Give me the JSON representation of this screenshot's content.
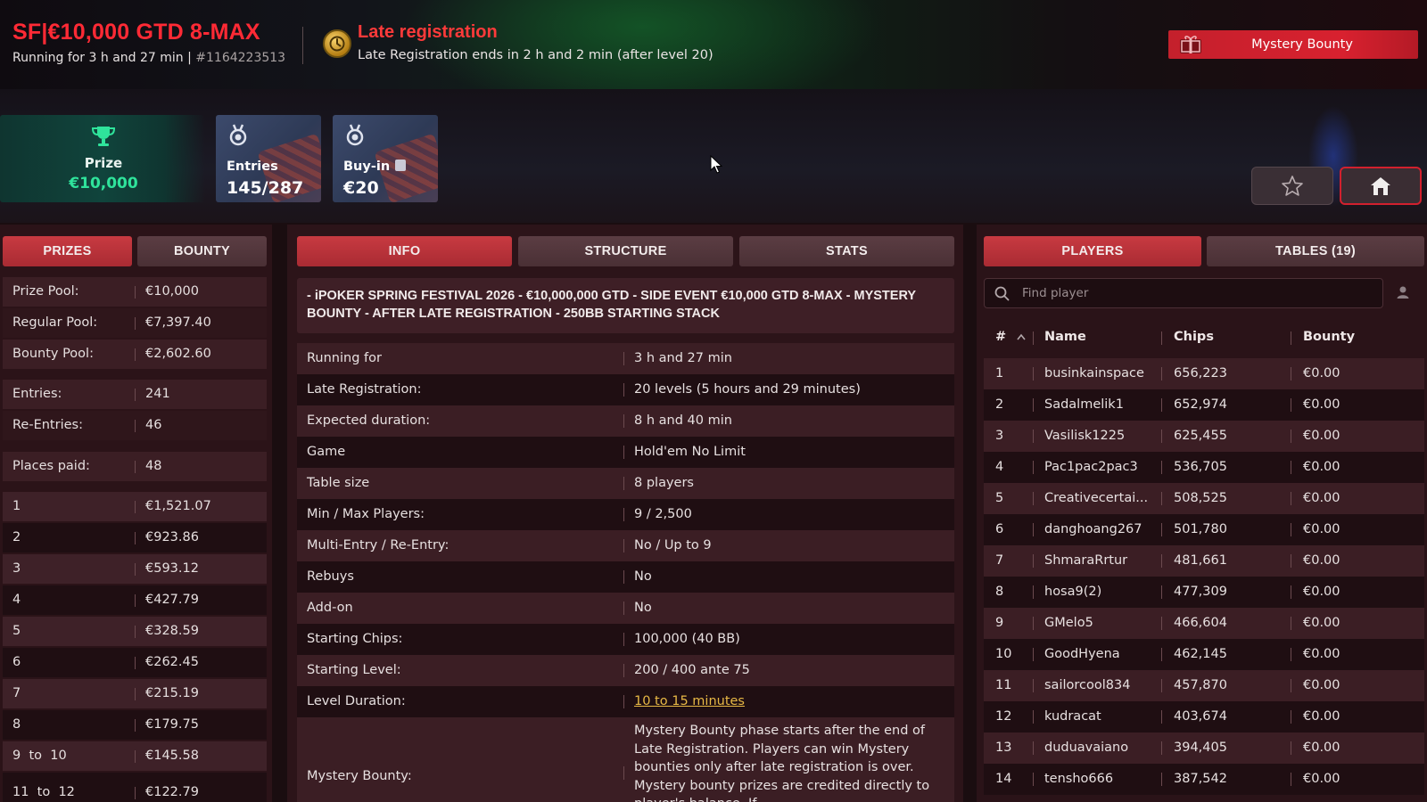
{
  "header": {
    "title": "SF|€10,000 GTD 8-MAX",
    "running": "Running for 3 h and 27 min | ",
    "tournament_id": "#1164223513",
    "late_reg_title": "Late registration",
    "late_reg_sub": "Late Registration ends in 2 h and 2 min (after level 20)",
    "mystery_button": "Mystery Bounty"
  },
  "cards": {
    "prize_label": "Prize",
    "prize_value": "€10,000",
    "entries_label": "Entries",
    "entries_value": "145/287",
    "buyin_label": "Buy-in",
    "buyin_value": "€20"
  },
  "left_tabs": [
    "PRIZES",
    "BOUNTY"
  ],
  "summary": [
    {
      "k": "Prize Pool:",
      "v": "€10,000"
    },
    {
      "k": "Regular Pool:",
      "v": "€7,397.40"
    },
    {
      "k": "Bounty Pool:",
      "v": "€2,602.60"
    },
    {
      "k": "Entries:",
      "v": "241"
    },
    {
      "k": "Re-Entries:",
      "v": "46"
    },
    {
      "k": "Places paid:",
      "v": "48"
    }
  ],
  "payouts": [
    {
      "place": "1",
      "amount": "€1,521.07"
    },
    {
      "place": "2",
      "amount": "€923.86"
    },
    {
      "place": "3",
      "amount": "€593.12"
    },
    {
      "place": "4",
      "amount": "€427.79"
    },
    {
      "place": "5",
      "amount": "€328.59"
    },
    {
      "place": "6",
      "amount": "€262.45"
    },
    {
      "place": "7",
      "amount": "€215.19"
    },
    {
      "place": "8",
      "amount": "€179.75"
    },
    {
      "place": "9  to  10",
      "amount": "€145.58"
    },
    {
      "place": "11  to  12",
      "amount": "€122.79"
    }
  ],
  "mid_tabs": [
    "INFO",
    "STRUCTURE",
    "STATS"
  ],
  "info": {
    "headline": "- iPOKER SPRING FESTIVAL 2026 - €10,000,000 GTD - SIDE EVENT €10,000 GTD 8-MAX - MYSTERY BOUNTY - AFTER LATE REGISTRATION - 250BB STARTING STACK",
    "rows": [
      {
        "k": "Running for",
        "v": "3 h and 27 min"
      },
      {
        "k": "Late Registration:",
        "v": "20 levels (5 hours and 29 minutes)"
      },
      {
        "k": "Expected duration:",
        "v": "8 h and 40 min"
      },
      {
        "k": "Game",
        "v": "Hold'em No Limit"
      },
      {
        "k": "Table size",
        "v": "8 players"
      },
      {
        "k": "Min / Max Players:",
        "v": "9 / 2,500"
      },
      {
        "k": "Multi-Entry / Re-Entry:",
        "v": "No / Up to 9"
      },
      {
        "k": "Rebuys",
        "v": "No"
      },
      {
        "k": "Add-on",
        "v": "No"
      },
      {
        "k": "Starting Chips:",
        "v": "100,000 (40 BB)"
      },
      {
        "k": "Starting Level:",
        "v": "200 / 400 ante 75"
      },
      {
        "k": "Level Duration:",
        "v": "10 to 15 minutes"
      }
    ],
    "mystery_label": "Mystery Bounty:",
    "mystery_text": "Mystery Bounty phase starts after the end of Late Registration. Players can win Mystery bounties only after late registration is over. Mystery bounty prizes are credited directly to player's balance. If"
  },
  "right_tabs": [
    "PLAYERS",
    "TABLES (19)"
  ],
  "search": {
    "placeholder": "Find player"
  },
  "players_header": {
    "rank": "#",
    "name": "Name",
    "chips": "Chips",
    "bounty": "Bounty"
  },
  "players": [
    {
      "rank": "1",
      "name": "businkainspace",
      "chips": "656,223",
      "bounty": "€0.00"
    },
    {
      "rank": "2",
      "name": "Sadalmelik1",
      "chips": "652,974",
      "bounty": "€0.00"
    },
    {
      "rank": "3",
      "name": "Vasilisk1225",
      "chips": "625,455",
      "bounty": "€0.00"
    },
    {
      "rank": "4",
      "name": "Pac1pac2pac3",
      "chips": "536,705",
      "bounty": "€0.00"
    },
    {
      "rank": "5",
      "name": "Creativecertai...",
      "chips": "508,525",
      "bounty": "€0.00"
    },
    {
      "rank": "6",
      "name": "danghoang267",
      "chips": "501,780",
      "bounty": "€0.00"
    },
    {
      "rank": "7",
      "name": "ShmaraRrtur",
      "chips": "481,661",
      "bounty": "€0.00"
    },
    {
      "rank": "8",
      "name": "hosa9(2)",
      "chips": "477,309",
      "bounty": "€0.00"
    },
    {
      "rank": "9",
      "name": "GMelo5",
      "chips": "466,604",
      "bounty": "€0.00"
    },
    {
      "rank": "10",
      "name": "GoodHyena",
      "chips": "462,145",
      "bounty": "€0.00"
    },
    {
      "rank": "11",
      "name": "sailorcool834",
      "chips": "457,870",
      "bounty": "€0.00"
    },
    {
      "rank": "12",
      "name": "kudracat",
      "chips": "403,674",
      "bounty": "€0.00"
    },
    {
      "rank": "13",
      "name": "duduavaiano",
      "chips": "394,405",
      "bounty": "€0.00"
    },
    {
      "rank": "14",
      "name": "tensho666",
      "chips": "387,542",
      "bounty": "€0.00"
    }
  ],
  "colors": {
    "accent": "#c83a41",
    "title_red": "#ff2a35",
    "prize_green": "#2fe39b",
    "link_gold": "#e7b845"
  }
}
